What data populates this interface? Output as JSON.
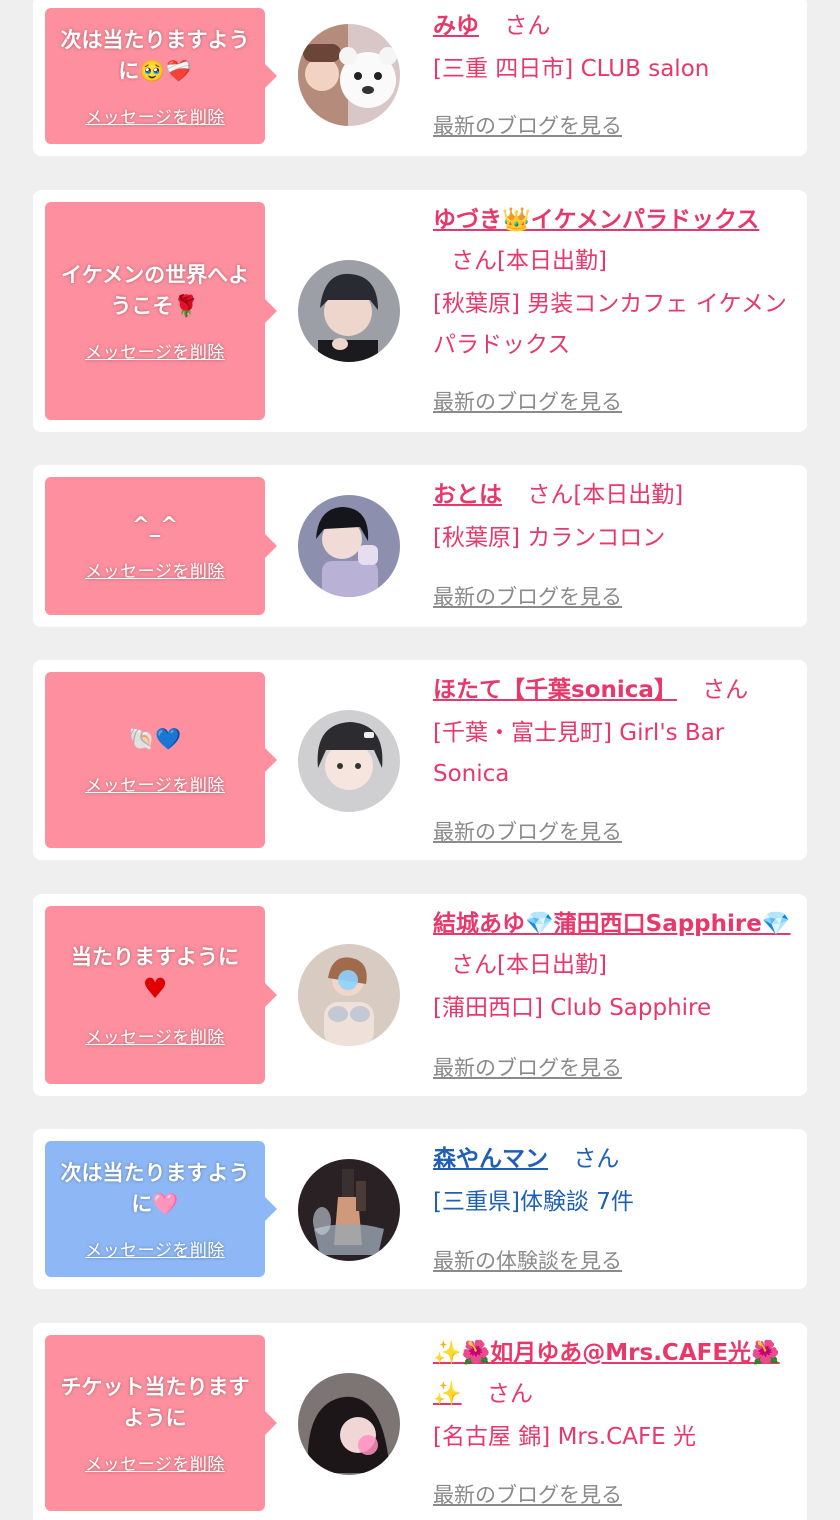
{
  "common": {
    "delete_label": "メッセージを削除",
    "san": "さん"
  },
  "cards": [
    {
      "message_text": "次は当たりますように",
      "message_emoji": "🥹❤️‍🩹",
      "name": "みゆ",
      "suffix": "さん",
      "shop": "[三重 四日市] CLUB salon",
      "link": "最新のブログを見る",
      "bubble_color": "#fd8f9e"
    },
    {
      "message_text": "イケメンの世界へようこそ",
      "message_emoji": "🌹",
      "name": "ゆづき👑イケメンパラドックス",
      "suffix": "さん[本日出勤]",
      "shop": "[秋葉原] 男装コンカフェ イケメンパラドックス",
      "link": "最新のブログを見る",
      "bubble_color": "#fd8f9e"
    },
    {
      "message_text": "^_^",
      "message_emoji": "",
      "name": "おとは",
      "suffix": "さん[本日出勤]",
      "shop": "[秋葉原] カランコロン",
      "link": "最新のブログを見る",
      "bubble_color": "#fd8f9e"
    },
    {
      "message_text": "",
      "message_emoji": "🐚💙",
      "name": "ほたて【千葉sonica】",
      "suffix": "さん",
      "shop": "[千葉・富士見町] Girl's Bar Sonica",
      "link": "最新のブログを見る",
      "bubble_color": "#fd8f9e"
    },
    {
      "message_text": "当たりますように",
      "message_emoji": "♥",
      "name": "結城あゆ💎蒲田西口Sapphire💎",
      "suffix": "さん[本日出勤]",
      "shop": "[蒲田西口] Club Sapphire",
      "link": "最新のブログを見る",
      "bubble_color": "#fd8f9e"
    },
    {
      "message_text": "次は当たりますように",
      "message_emoji": "🩷",
      "name": "森やんマン",
      "suffix": "さん",
      "shop": "[三重県]体験談 7件",
      "link": "最新の体験談を見る",
      "bubble_color": "#8db8f5"
    },
    {
      "message_text": "チケット当たりますように",
      "message_emoji": "",
      "name": "✨🌺如月ゆあ@Mrs.CAFE光🌺✨",
      "suffix": "さん",
      "shop": "[名古屋 錦] Mrs.CAFE 光",
      "link": "最新のブログを見る",
      "bubble_color": "#fd8f9e"
    }
  ],
  "icons": [
    "avatar-photo-icon",
    "speech-bubble-pointer"
  ]
}
